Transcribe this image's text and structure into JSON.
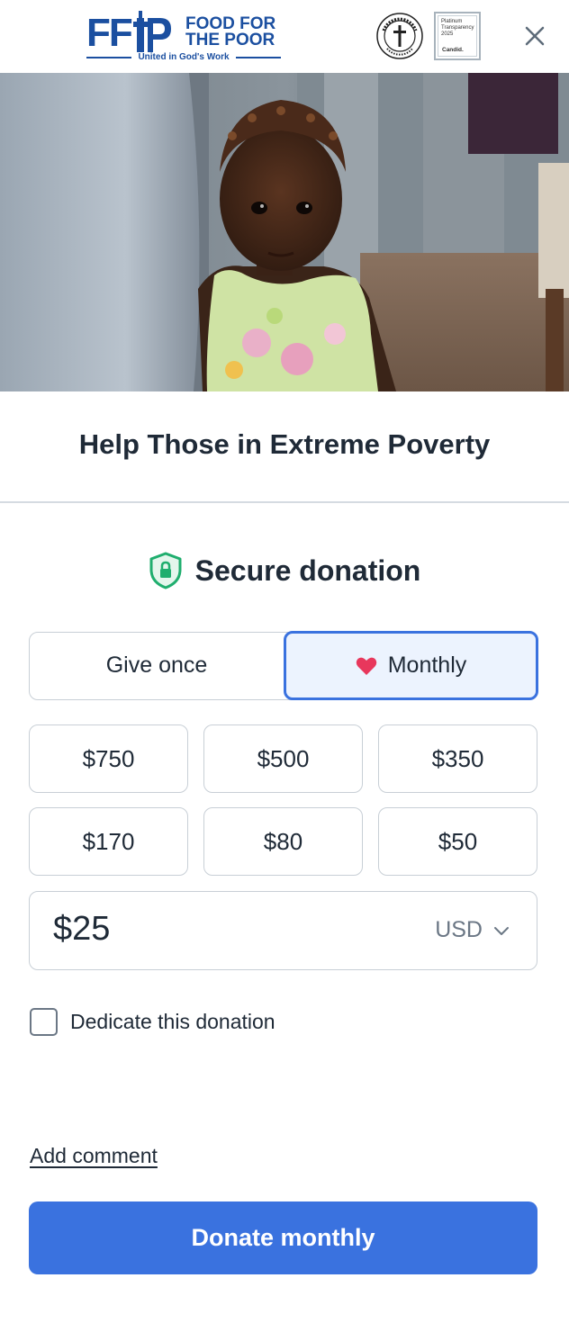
{
  "header": {
    "logo_mark": "FF",
    "logo_name_line1": "FOOD FOR",
    "logo_name_line2": "THE POOR",
    "logo_tagline": "United in God's Work",
    "seal_text": "FAITHFUL STEWARDS · SINCE 1983",
    "candid_badge": {
      "line1": "Platinum",
      "line2": "Transparency",
      "line3": "2025",
      "brand": "Candid."
    },
    "close_icon": "close-icon"
  },
  "hero": {
    "icon": "hero-photo"
  },
  "title": "Help Those in Extreme Poverty",
  "secure": {
    "label": "Secure donation",
    "icon": "shield-lock-icon"
  },
  "frequency": {
    "once_label": "Give once",
    "monthly_label": "Monthly",
    "selected": "monthly",
    "monthly_icon": "heart-icon"
  },
  "amounts": [
    "$750",
    "$500",
    "$350",
    "$170",
    "$80",
    "$50"
  ],
  "amount_input": {
    "value": "$25",
    "currency": "USD"
  },
  "dedicate": {
    "label": "Dedicate this donation",
    "checked": false
  },
  "add_comment": "Add comment",
  "donate_button": "Donate monthly",
  "colors": {
    "brand_blue": "#1b4fa0",
    "accent_blue": "#3a72df",
    "selected_bg": "#ecf3fe",
    "shield_green": "#1fae6e",
    "heart_pink": "#e8375c"
  }
}
